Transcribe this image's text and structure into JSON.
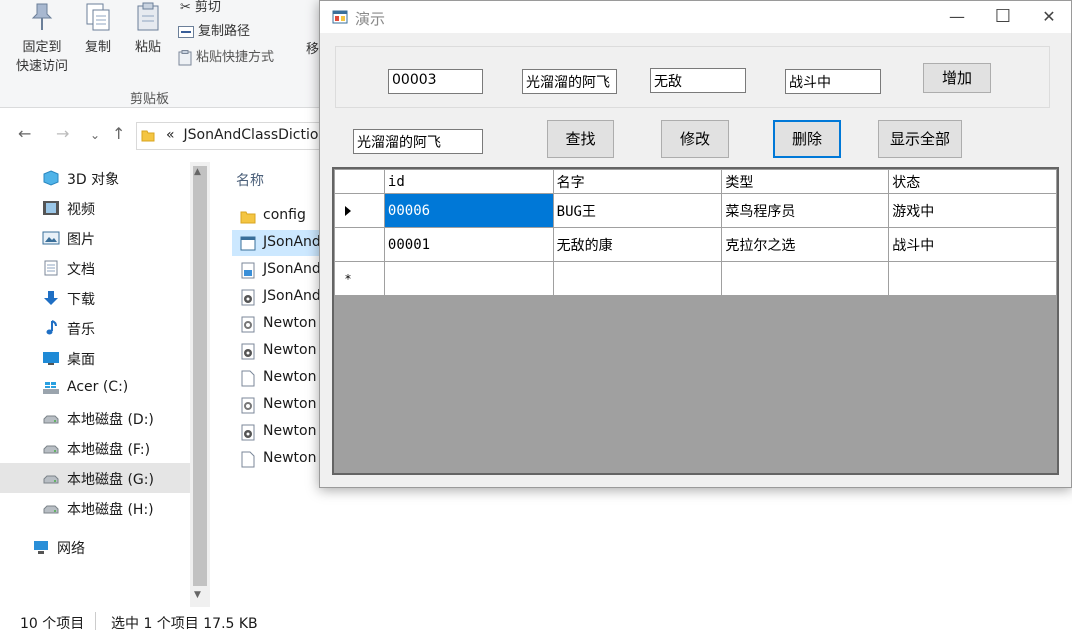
{
  "explorer": {
    "ribbon": {
      "pin_label_1": "固定到",
      "pin_label_2": "快速访问",
      "copy_label": "复制",
      "paste_label": "粘贴",
      "cut_label": "剪切",
      "copy_path_label": "复制路径",
      "paste_shortcut_label": "粘贴快捷方式",
      "move_label": "移",
      "group_label": "剪贴板"
    },
    "address": "JSonAndClassDictio",
    "address_prefix": "«",
    "column_header": "名称",
    "tree": [
      {
        "label": "3D 对象",
        "icon": "cube-icon"
      },
      {
        "label": "视频",
        "icon": "video-icon"
      },
      {
        "label": "图片",
        "icon": "picture-icon"
      },
      {
        "label": "文档",
        "icon": "document-icon"
      },
      {
        "label": "下载",
        "icon": "download-icon"
      },
      {
        "label": "音乐",
        "icon": "music-icon"
      },
      {
        "label": "桌面",
        "icon": "desktop-icon"
      },
      {
        "label": "Acer (C:)",
        "icon": "drive-icon"
      },
      {
        "label": "本地磁盘 (D:)",
        "icon": "drive-icon"
      },
      {
        "label": "本地磁盘 (F:)",
        "icon": "drive-icon"
      },
      {
        "label": "本地磁盘 (G:)",
        "icon": "drive-icon"
      },
      {
        "label": "本地磁盘 (H:)",
        "icon": "drive-icon"
      },
      {
        "label": "网络",
        "icon": "network-icon"
      }
    ],
    "files": [
      {
        "label": "config",
        "icon": "folder-icon"
      },
      {
        "label": "JSonAnd",
        "icon": "exe-icon"
      },
      {
        "label": "JSonAnd",
        "icon": "config-file-icon"
      },
      {
        "label": "JSonAnd",
        "icon": "dll-icon"
      },
      {
        "label": "Newton",
        "icon": "settings-file-icon"
      },
      {
        "label": "Newton",
        "icon": "dll-icon"
      },
      {
        "label": "Newton",
        "icon": "blank-file-icon"
      },
      {
        "label": "Newton",
        "icon": "settings-file-icon"
      },
      {
        "label": "Newton",
        "icon": "dll-icon"
      },
      {
        "label": "Newton",
        "icon": "blank-file-icon"
      }
    ],
    "status": {
      "count": "10 个项目",
      "selected": "选中 1 个项目  17.5 KB"
    }
  },
  "form": {
    "title": "演示",
    "minimize": "—",
    "maximize": "☐",
    "close": "✕",
    "inputs": {
      "id": "00003",
      "name": "光溜溜的阿飞",
      "type": "无敌",
      "state": "战斗中",
      "search": "光溜溜的阿飞"
    },
    "buttons": {
      "add": "增加",
      "find": "查找",
      "edit": "修改",
      "delete": "删除",
      "show_all": "显示全部"
    },
    "grid": {
      "columns": [
        "id",
        "名字",
        "类型",
        "状态"
      ],
      "rows": [
        [
          "00006",
          "BUG王",
          "菜鸟程序员",
          "游戏中"
        ],
        [
          "00001",
          "无敌的康",
          "克拉尔之选",
          "战斗中"
        ]
      ],
      "new_row_marker": "*"
    }
  },
  "colors": {
    "selection": "#0078d7",
    "grid_background": "#a0a0a0",
    "form_background": "#f0f0f0"
  }
}
